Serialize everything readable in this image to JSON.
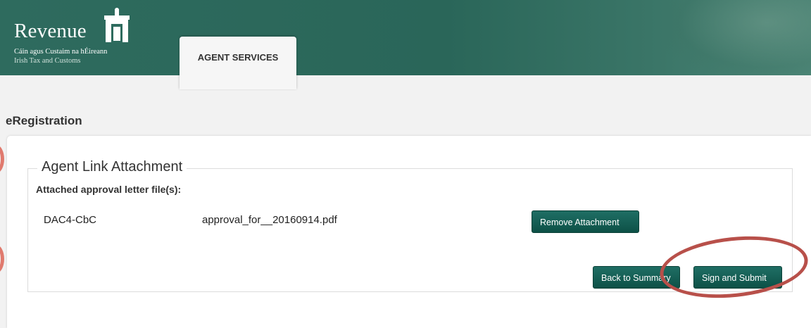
{
  "header": {
    "logo": {
      "wordmark": "Revenue",
      "subtitle_irish": "Cáin agus Custaim na hÉireann",
      "subtitle_english": "Irish Tax and Customs",
      "crest_icon": "harp-crest-icon"
    },
    "tab_label": "AGENT SERVICES"
  },
  "page_title": "eRegistration",
  "section": {
    "legend": "Agent Link Attachment",
    "attached_label": "Attached approval letter file(s):",
    "attachments": [
      {
        "type": "DAC4-CbC",
        "filename": "approval_for__20160914.pdf",
        "action": "Remove Attachment"
      }
    ]
  },
  "buttons": {
    "back": "Back to Summary",
    "sign": "Sign and Submit"
  },
  "colors": {
    "banner": "#2e6b5e",
    "button": "#165f55",
    "highlight": "#b8504a"
  }
}
